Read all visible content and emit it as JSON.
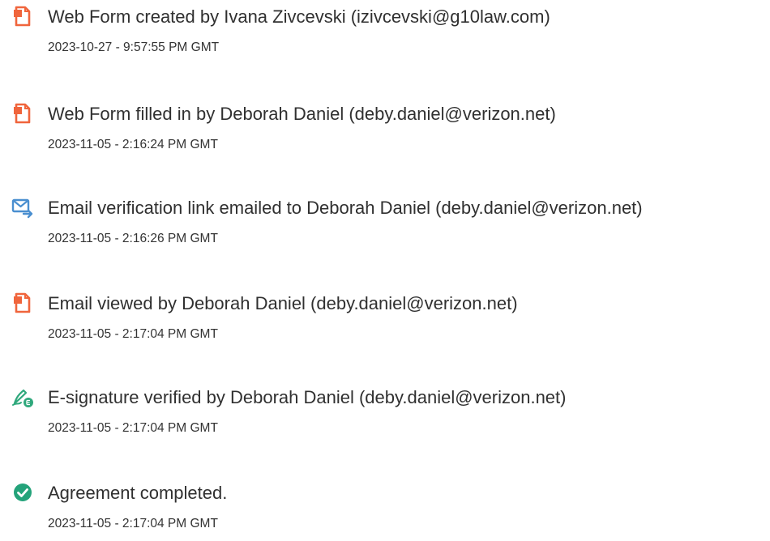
{
  "events": [
    {
      "icon": "document-icon",
      "text": "Web Form created by Ivana Zivcevski (izivcevski@g10law.com)",
      "timestamp": "2023-10-27 - 9:57:55 PM GMT"
    },
    {
      "icon": "document-icon",
      "text": "Web Form filled in by Deborah Daniel (deby.daniel@verizon.net)",
      "timestamp": "2023-11-05 - 2:16:24 PM GMT"
    },
    {
      "icon": "email-send-icon",
      "text": "Email verification link emailed to Deborah Daniel (deby.daniel@verizon.net)",
      "timestamp": "2023-11-05 - 2:16:26 PM GMT"
    },
    {
      "icon": "document-icon",
      "text": "Email viewed by Deborah Daniel (deby.daniel@verizon.net)",
      "timestamp": "2023-11-05 - 2:17:04 PM GMT"
    },
    {
      "icon": "esignature-icon",
      "text": "E-signature verified by Deborah Daniel (deby.daniel@verizon.net)",
      "timestamp": "2023-11-05 - 2:17:04 PM GMT"
    },
    {
      "icon": "checkmark-icon",
      "text": "Agreement completed.",
      "timestamp": "2023-11-05 - 2:17:04 PM GMT"
    }
  ],
  "colors": {
    "document_icon": "#f0653c",
    "email_icon": "#4a8fd0",
    "signature_icon": "#2fa87c",
    "check_icon": "#24a37a",
    "text": "#303030"
  }
}
